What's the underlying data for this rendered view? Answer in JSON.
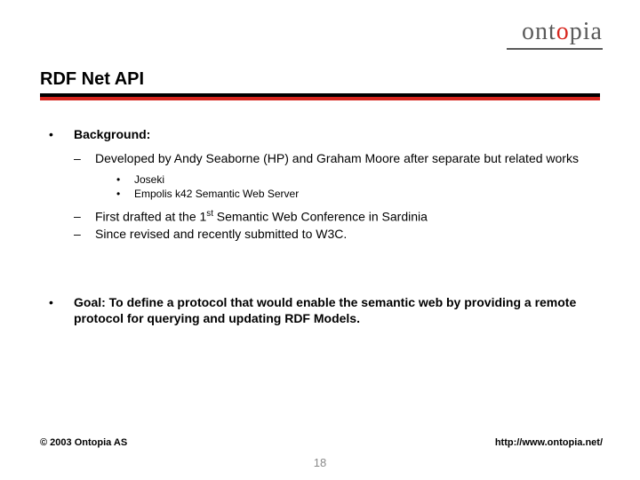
{
  "logo": {
    "part1": "ont",
    "accent": "o",
    "part2": "pia"
  },
  "title": "RDF Net API",
  "bullets": {
    "background": {
      "label": "Background:",
      "sub": [
        "Developed by Andy Seaborne (HP) and Graham Moore after separate but related works"
      ],
      "subsub": [
        "Joseki",
        "Empolis k42 Semantic Web Server"
      ],
      "sub2_prefix": "First drafted at the 1",
      "sub2_ord": "st",
      "sub2_suffix": " Semantic Web Conference in Sardinia",
      "sub3": "Since revised and recently submitted to W3C."
    },
    "goal": "Goal: To define a protocol that would enable the semantic web by providing a remote protocol for querying and updating RDF Models."
  },
  "footer": {
    "copyright": "© 2003 Ontopia AS",
    "url": "http://www.ontopia.net/",
    "page": "18"
  }
}
